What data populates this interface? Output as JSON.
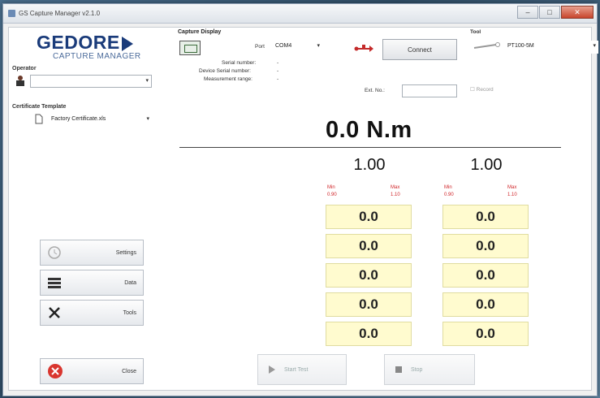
{
  "window": {
    "title": "GS Capture Manager v2.1.0",
    "min": "–",
    "max": "□",
    "close": "✕"
  },
  "logo": {
    "brand": "GEDORE",
    "subtitle": "CAPTURE MANAGER"
  },
  "operator": {
    "label": "Operator",
    "value": ""
  },
  "certificate": {
    "label": "Certificate Template",
    "value": "Factory Certificate.xls"
  },
  "side_buttons": [
    {
      "label": "Settings",
      "icon": "clock-icon"
    },
    {
      "label": "Data",
      "icon": "list-icon"
    },
    {
      "label": "Tools",
      "icon": "tools-icon"
    }
  ],
  "close_button": {
    "label": "Close"
  },
  "capture": {
    "title": "Capture Display",
    "port_label": "Port",
    "port_value": "COM4",
    "connect_label": "Connect",
    "serial_label": "Serial number:",
    "serial_value": "-",
    "device_serial_label": "Device Serial number:",
    "device_serial_value": "-",
    "range_label": "Measurement range:",
    "range_value": "-",
    "ext_label": "Ext. No.:",
    "ext_value": "",
    "record_label": "Record"
  },
  "tool": {
    "label": "Tool",
    "value": "PT100-5M"
  },
  "reading": {
    "value": "0.0 N.m"
  },
  "columns": [
    {
      "target": "1.00",
      "min_label": "Min",
      "max_label": "Max",
      "min_value": "0.90",
      "max_value": "1.10",
      "cells": [
        "0.0",
        "0.0",
        "0.0",
        "0.0",
        "0.0"
      ]
    },
    {
      "target": "1.00",
      "min_label": "Min",
      "max_label": "Max",
      "min_value": "0.90",
      "max_value": "1.10",
      "cells": [
        "0.0",
        "0.0",
        "0.0",
        "0.0",
        "0.0"
      ]
    }
  ],
  "start_button": {
    "label": "Start Test"
  },
  "stop_button": {
    "label": "Stop"
  }
}
